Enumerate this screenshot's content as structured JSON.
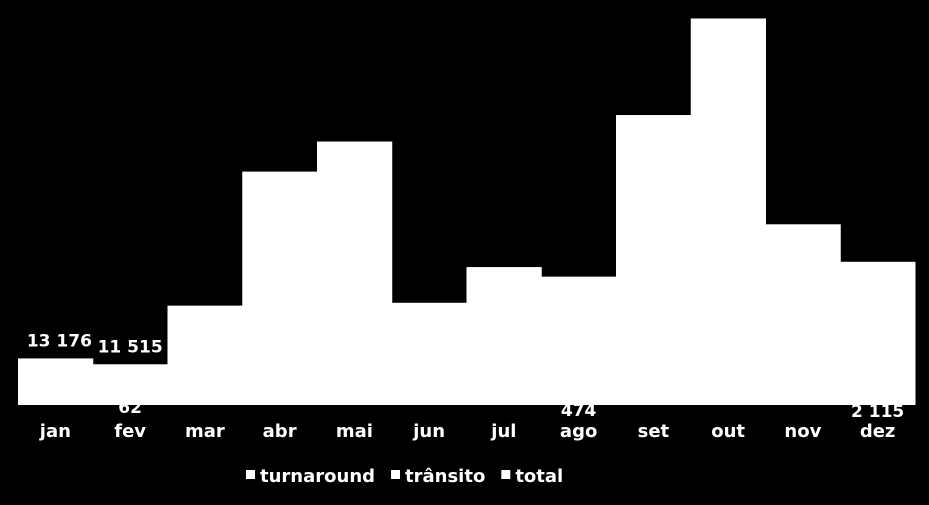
{
  "chart_data": {
    "type": "bar",
    "categories": [
      "jan",
      "fev",
      "mar",
      "abr",
      "mai",
      "jun",
      "jul",
      "ago",
      "set",
      "out",
      "nov",
      "dez"
    ],
    "series": [
      {
        "name": "turnaround",
        "values": [
          null,
          62,
          null,
          null,
          null,
          null,
          null,
          474,
          null,
          null,
          null,
          2115
        ]
      },
      {
        "name": "trânsito",
        "values": [
          null,
          null,
          null,
          null,
          null,
          null,
          null,
          null,
          null,
          null,
          null,
          null
        ]
      },
      {
        "name": "total",
        "values": [
          13176,
          11515,
          28100,
          66000,
          74500,
          28900,
          39000,
          36300,
          82000,
          109300,
          51100,
          40500
        ]
      }
    ],
    "data_labels": {
      "total": [
        "13 176",
        "11 515",
        "",
        "",
        "",
        "",
        "",
        "",
        "",
        "",
        "",
        ""
      ],
      "turnaround": [
        "",
        "62",
        "",
        "",
        "",
        "",
        "",
        "474",
        "",
        "",
        "",
        "2 115"
      ]
    },
    "ylim": [
      0,
      110000
    ],
    "grid": false,
    "legend": "bottom",
    "colors": {
      "background": "#000000",
      "bars": "#ffffff",
      "text": "#ffffff"
    }
  }
}
